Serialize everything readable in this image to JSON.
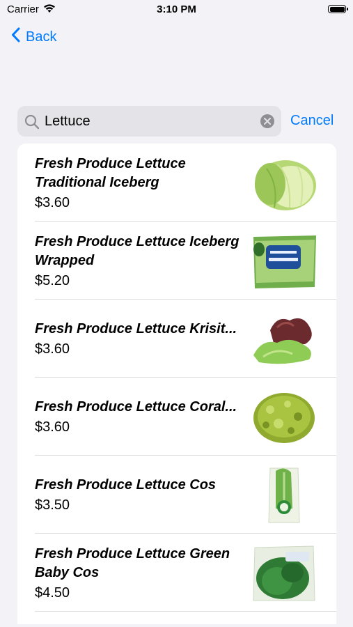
{
  "status_bar": {
    "carrier": "Carrier",
    "time": "3:10 PM"
  },
  "nav": {
    "back_label": "Back"
  },
  "search": {
    "value": "Lettuce",
    "cancel_label": "Cancel"
  },
  "products": [
    {
      "name": "Fresh Produce Lettuce Traditional Iceberg",
      "price": "$3.60",
      "image": "iceberg-lettuce-head"
    },
    {
      "name": "Fresh Produce Lettuce Iceberg Wrapped",
      "price": "$5.20",
      "image": "wrapped-iceberg-bag"
    },
    {
      "name": "Fresh Produce Lettuce Krisit...",
      "price": "$3.60",
      "image": "red-green-lettuce-leaves"
    },
    {
      "name": "Fresh Produce Lettuce Coral...",
      "price": "$3.60",
      "image": "coral-lettuce-head"
    },
    {
      "name": "Fresh Produce Lettuce Cos",
      "price": "$3.50",
      "image": "cos-lettuce-bag"
    },
    {
      "name": "Fresh Produce Lettuce Green Baby Cos",
      "price": "$4.50",
      "image": "baby-cos-bag"
    }
  ],
  "colors": {
    "accent": "#007aff",
    "background": "#f2f2f7",
    "search_field": "#e3e3e8"
  }
}
